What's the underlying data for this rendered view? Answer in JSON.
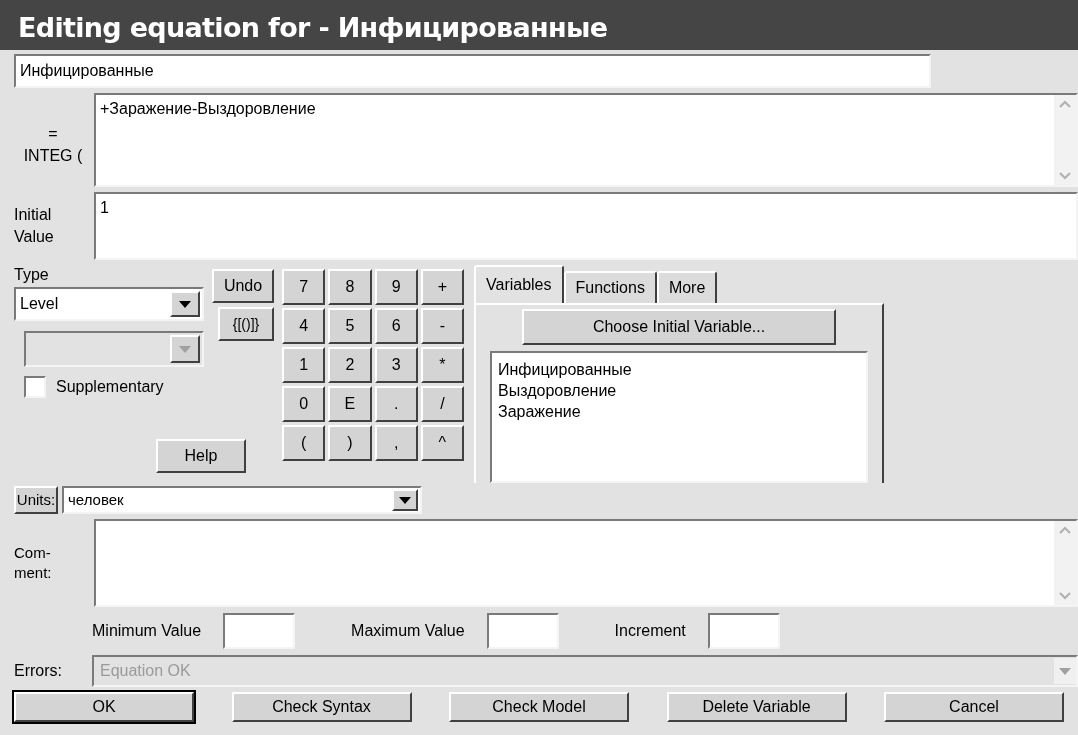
{
  "window": {
    "title": "Editing equation for - Инфицированные"
  },
  "name_field": {
    "value": "Инфицированные"
  },
  "equation": {
    "label_lines": [
      "=",
      "INTEG ("
    ],
    "value": "+Заражение-Выздоровление"
  },
  "initial_value": {
    "label_lines": [
      "Initial",
      "Value"
    ],
    "value": "1"
  },
  "type": {
    "label": "Type",
    "value": "Level",
    "subtype_disabled": true
  },
  "supplementary": {
    "label": "Supplementary",
    "checked": false
  },
  "undo_button": "Undo",
  "brackets_button": "{[()]}",
  "help_button": "Help",
  "keypad": [
    [
      "7",
      "8",
      "9",
      "+"
    ],
    [
      "4",
      "5",
      "6",
      "-"
    ],
    [
      "1",
      "2",
      "3",
      "*"
    ],
    [
      "0",
      "E",
      ".",
      "/"
    ],
    [
      "(",
      ")",
      ",",
      "^"
    ]
  ],
  "tabs": [
    {
      "label": "Variables",
      "selected": true
    },
    {
      "label": "Functions",
      "selected": false
    },
    {
      "label": "More",
      "selected": false
    }
  ],
  "choose_button": "Choose Initial Variable...",
  "variables": [
    "Инфицированные",
    "Выздоровление",
    "Заражение"
  ],
  "units": {
    "button": "Units:",
    "value": "человек"
  },
  "comment": {
    "label_lines": [
      "Com-",
      "ment:"
    ]
  },
  "ranges": [
    {
      "label": "Minimum Value"
    },
    {
      "label": "Maximum Value"
    },
    {
      "label": "Increment"
    }
  ],
  "errors": {
    "label": "Errors:",
    "value": "Equation OK",
    "disabled": true
  },
  "actions": [
    {
      "label": "OK",
      "default": true
    },
    {
      "label": "Check Syntax",
      "default": false
    },
    {
      "label": "Check Model",
      "default": false
    },
    {
      "label": "Delete Variable",
      "default": false
    },
    {
      "label": "Cancel",
      "default": false
    }
  ]
}
